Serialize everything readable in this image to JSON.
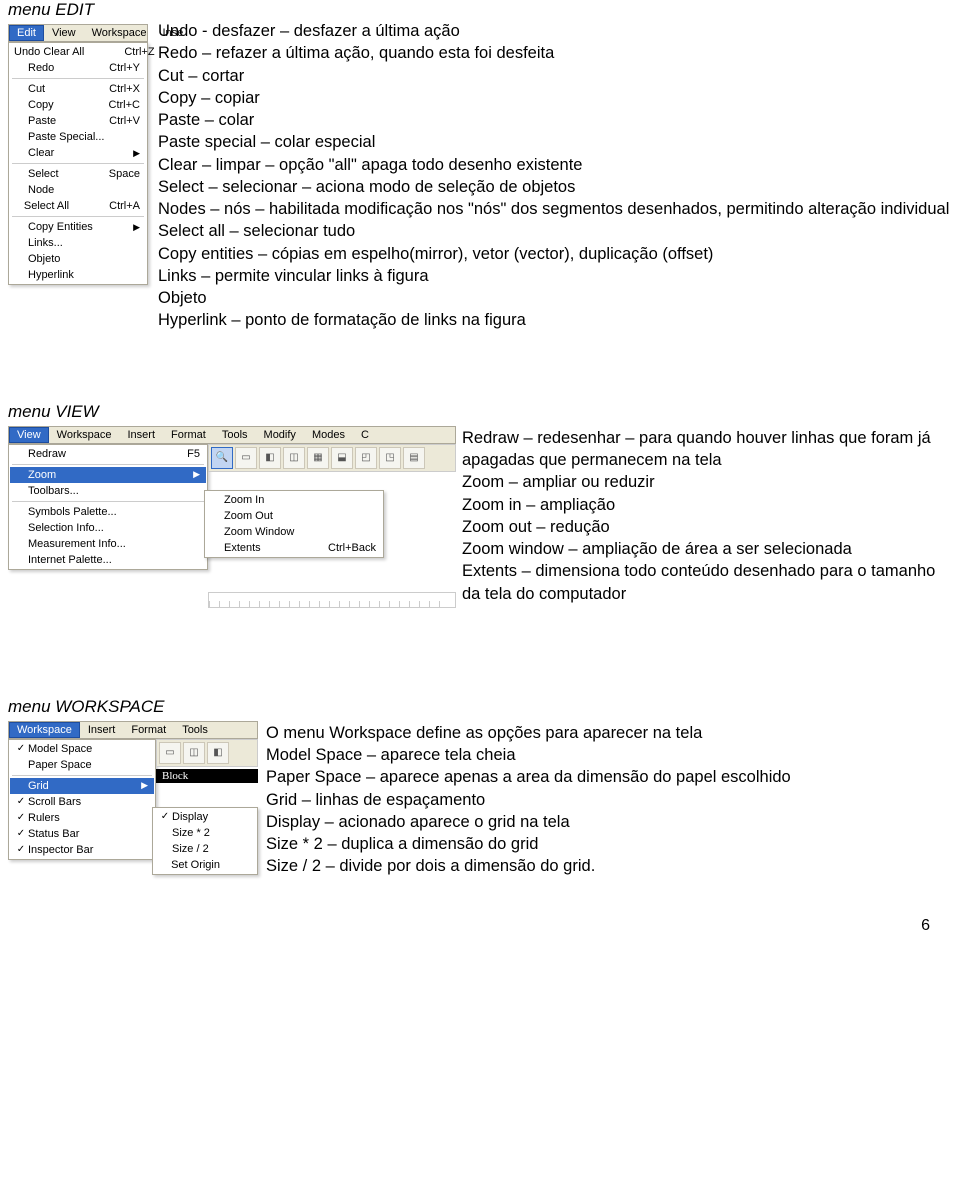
{
  "page_number": "6",
  "edit": {
    "title": "menu EDIT",
    "menubar": [
      "Edit",
      "View",
      "Workspace",
      "Inse"
    ],
    "active_index": 0,
    "items": [
      {
        "label": "Undo Clear All",
        "shortcut": "Ctrl+Z"
      },
      {
        "label": "Redo",
        "shortcut": "Ctrl+Y"
      },
      {
        "sep": true
      },
      {
        "label": "Cut",
        "shortcut": "Ctrl+X"
      },
      {
        "label": "Copy",
        "shortcut": "Ctrl+C"
      },
      {
        "label": "Paste",
        "shortcut": "Ctrl+V"
      },
      {
        "label": "Paste Special..."
      },
      {
        "label": "Clear",
        "arrow": true
      },
      {
        "sep": true
      },
      {
        "label": "Select",
        "shortcut": "Space"
      },
      {
        "label": "Node"
      },
      {
        "label": "Select All",
        "shortcut": "Ctrl+A"
      },
      {
        "sep": true
      },
      {
        "label": "Copy Entities",
        "arrow": true
      },
      {
        "label": "Links..."
      },
      {
        "label": "Objeto"
      },
      {
        "label": "Hyperlink"
      }
    ],
    "desc_lines": [
      "Undo  - desfazer – desfazer a última ação",
      "Redo – refazer a última ação, quando esta foi desfeita",
      "Cut – cortar",
      "Copy – copiar",
      "Paste – colar",
      "Paste special – colar especial",
      "Clear – limpar – opção \"all\" apaga todo desenho existente",
      "Select – selecionar – aciona modo de seleção de objetos",
      "Nodes – nós – habilitada modificação nos \"nós\" dos segmentos desenhados, permitindo alteração individual",
      "Select all – selecionar tudo",
      "Copy entities – cópias em espelho(mirror), vetor (vector), duplicação (offset)",
      "Links – permite vincular links à figura",
      "Objeto",
      "Hyperlink – ponto de formatação de links na figura"
    ]
  },
  "view": {
    "title": "menu VIEW",
    "menubar": [
      "View",
      "Workspace",
      "Insert",
      "Format",
      "Tools",
      "Modify",
      "Modes",
      "C"
    ],
    "active_index": 0,
    "items": [
      {
        "label": "Redraw",
        "shortcut": "F5"
      },
      {
        "sep": true
      },
      {
        "label": "Zoom",
        "arrow": true,
        "highlight": true
      },
      {
        "label": "Toolbars..."
      },
      {
        "sep": true
      },
      {
        "label": "Symbols Palette..."
      },
      {
        "label": "Selection Info..."
      },
      {
        "label": "Measurement Info..."
      },
      {
        "label": "Internet Palette..."
      }
    ],
    "zoom_submenu": [
      {
        "label": "Zoom In"
      },
      {
        "label": "Zoom Out"
      },
      {
        "label": "Zoom Window"
      },
      {
        "label": "Extents",
        "shortcut": "Ctrl+Back"
      }
    ],
    "desc_lines": [
      "Redraw – redesenhar – para quando houver linhas que foram já apagadas que permanecem na tela",
      "Zoom – ampliar ou reduzir",
      "Zoom in – ampliação",
      "Zoom out – redução",
      "Zoom window – ampliação de área a ser selecionada",
      "Extents – dimensiona todo conteúdo desenhado para o tamanho da tela do computador"
    ]
  },
  "workspace": {
    "title": "menu WORKSPACE",
    "menubar": [
      "Workspace",
      "Insert",
      "Format",
      "Tools"
    ],
    "active_index": 0,
    "items": [
      {
        "chk": true,
        "label": "Model Space"
      },
      {
        "label": "Paper Space"
      },
      {
        "sep": true
      },
      {
        "label": "Grid",
        "arrow": true,
        "highlight": true
      },
      {
        "chk": true,
        "label": "Scroll Bars"
      },
      {
        "chk": true,
        "label": "Rulers"
      },
      {
        "chk": true,
        "label": "Status Bar"
      },
      {
        "chk": true,
        "label": "Inspector Bar"
      }
    ],
    "grid_submenu": [
      {
        "chk": true,
        "label": "Display"
      },
      {
        "label": "Size * 2"
      },
      {
        "label": "Size / 2"
      },
      {
        "label": "Set Origin"
      }
    ],
    "blackstrip_label": "Block",
    "desc_lines": [
      "O menu Workspace define as opções para aparecer na tela",
      "Model Space – aparece tela cheia",
      "Paper Space – aparece apenas a area da dimensão do papel escolhido",
      "Grid –  linhas de espaçamento",
      "Display – acionado aparece o grid na tela",
      "Size * 2 – duplica a dimensão do grid",
      "Size / 2 – divide por dois a dimensão do grid."
    ]
  }
}
